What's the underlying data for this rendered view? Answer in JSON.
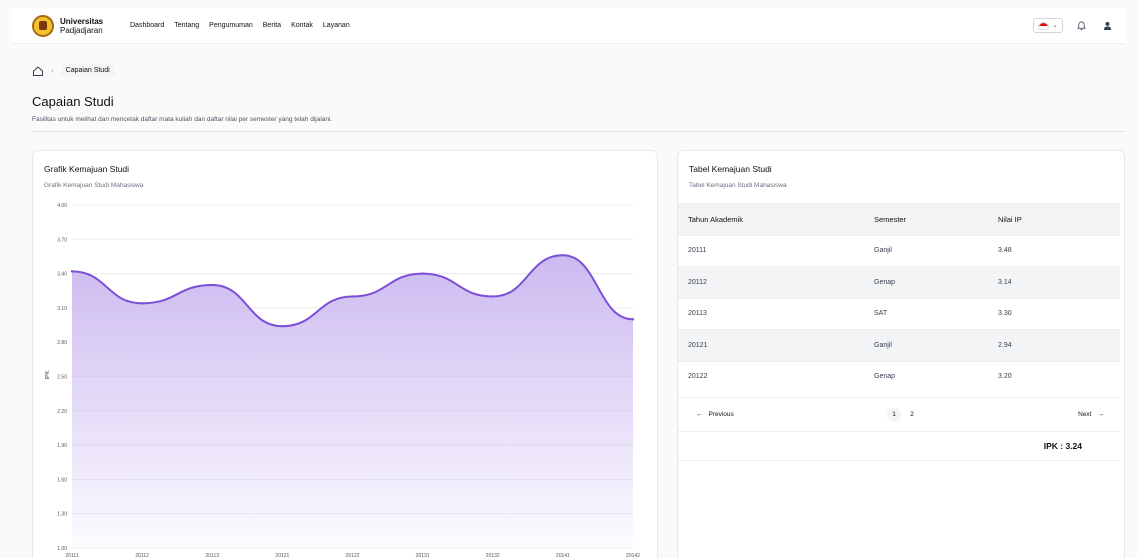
{
  "header": {
    "brand_line1": "Universitas",
    "brand_line2": "Padjadjaran",
    "nav": [
      "Dashboard",
      "Tentang",
      "Pengumuman",
      "Berita",
      "Kontak",
      "Layanan"
    ]
  },
  "breadcrumb": {
    "current": "Capaian Studi"
  },
  "page": {
    "title": "Capaian Studi",
    "description": "Fasilitas untuk melihat dan mencetak daftar mata kuliah dan daftar nilai per semester yang telah dijalani."
  },
  "chart_card": {
    "title": "Grafik Kemajuan Studi",
    "subtitle": "Grafik Kemajuan Studi Mahasiswa"
  },
  "chart_data": {
    "type": "area",
    "categories": [
      "20111",
      "20112",
      "20113",
      "20121",
      "20122",
      "20131",
      "20132",
      "20141",
      "20142"
    ],
    "values": [
      3.42,
      3.14,
      3.3,
      2.94,
      3.2,
      3.4,
      3.2,
      3.56,
      3.0
    ],
    "ylabel": "IPK",
    "ylim": [
      1.0,
      4.0
    ],
    "yticks": [
      "4.00",
      "3.70",
      "3.40",
      "3.10",
      "2.80",
      "2.50",
      "2.20",
      "1.90",
      "1.60",
      "1.30",
      "1.00"
    ],
    "color": "#7c4fd6",
    "grid": true
  },
  "table_card": {
    "title": "Tabel Kemajuan Studi",
    "subtitle": "Tabel Kemajuan Studi Mahasiswa",
    "columns": [
      "Tahun Akademik",
      "Semester",
      "Nilai IP"
    ],
    "rows": [
      [
        "20111",
        "Ganjil",
        "3.48"
      ],
      [
        "20112",
        "Genap",
        "3.14"
      ],
      [
        "20113",
        "SAT",
        "3.30"
      ],
      [
        "20121",
        "Ganjil",
        "2.94"
      ],
      [
        "20122",
        "Genap",
        "3.20"
      ]
    ],
    "pagination": {
      "prev": "Previous",
      "next": "Next",
      "pages": [
        "1",
        "2"
      ],
      "active": 0
    },
    "ipk": "IPK : 3.24"
  },
  "colors": {
    "accent": "#7c4fd6",
    "accent_light": "#c9b6f0"
  }
}
